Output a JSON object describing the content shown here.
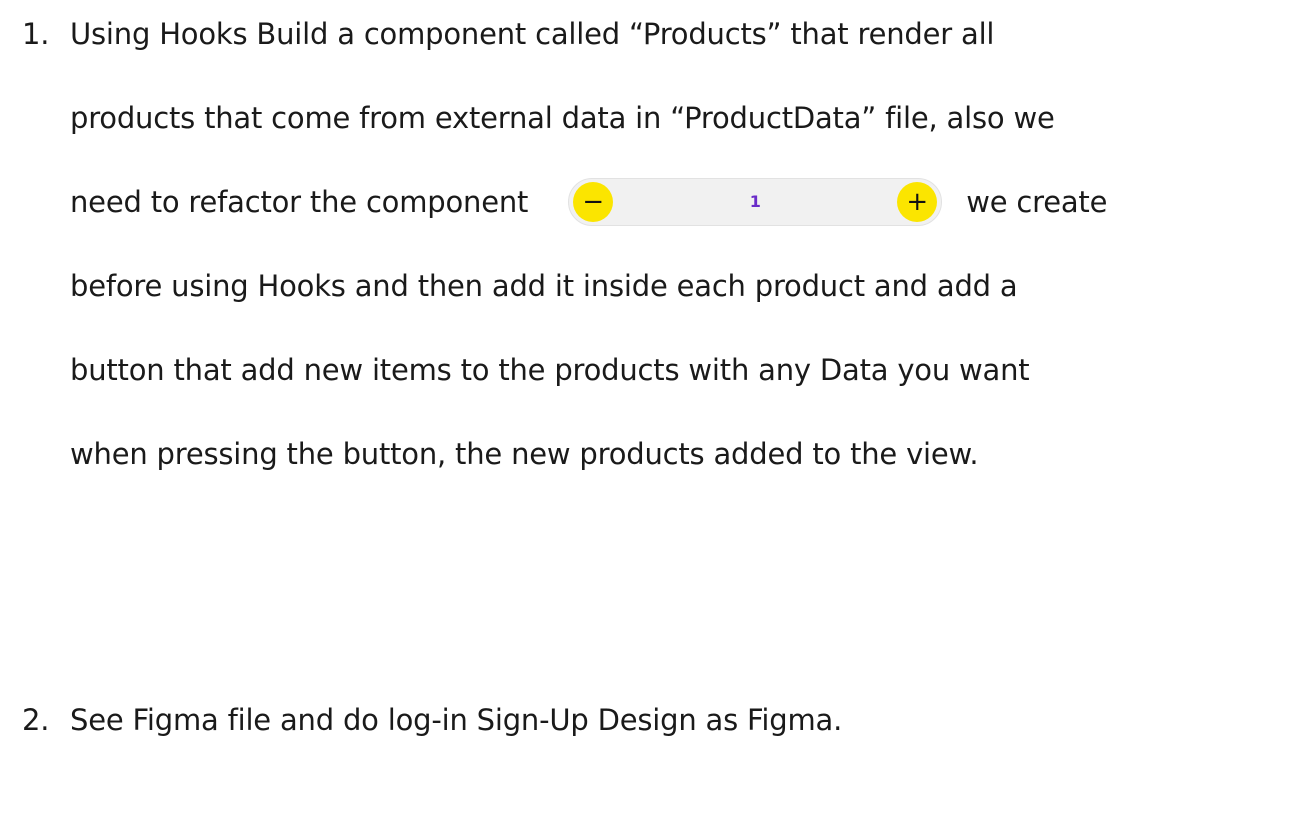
{
  "items": [
    {
      "number": "1.",
      "lines": [
        "Using Hooks Build a component called “Products” that render all",
        "products that come from external data in “ProductData” file, also we",
        "need to refactor the component",
        "we create",
        "before using Hooks and then add it inside each product and add a",
        "button that add new items to the products with any Data you want",
        "when pressing the button, the new products added to the view."
      ],
      "stepper": {
        "minus": "−",
        "value": "1",
        "plus": "+"
      }
    },
    {
      "number": "2.",
      "lines": [
        "See Figma file and do log-in Sign-Up Design as Figma."
      ]
    }
  ],
  "colors": {
    "stepper_button": "#fbe500",
    "stepper_background": "#f1f1f1",
    "stepper_value": "#6a2cc9"
  }
}
